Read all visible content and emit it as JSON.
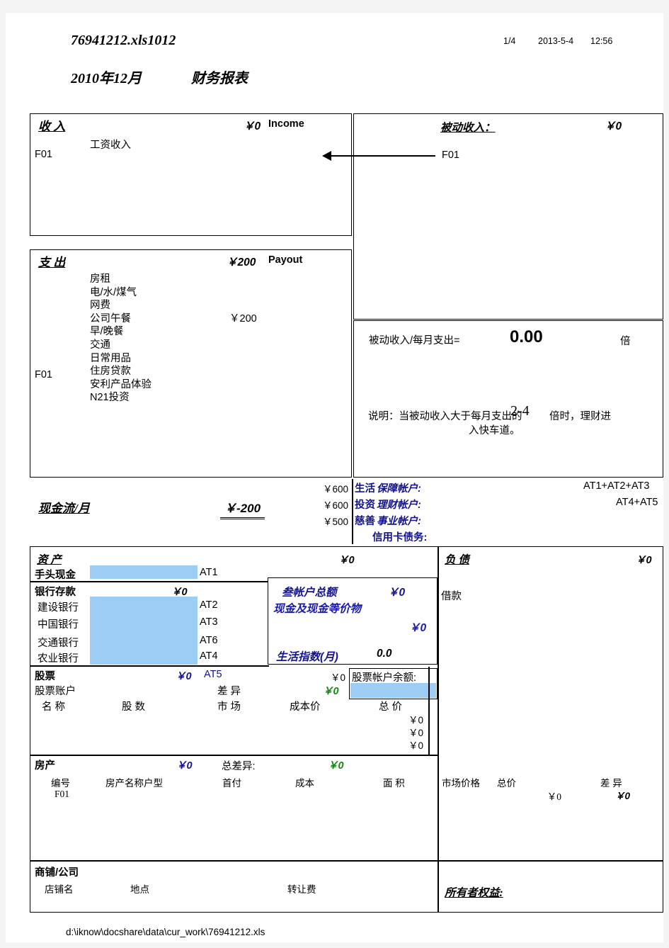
{
  "header": {
    "filename": "76941212.xls1012",
    "page_number": "1/4",
    "date": "2013-5-4",
    "time": "12:56",
    "period": "2010年12月",
    "doc_title": "财务报表"
  },
  "income": {
    "title": "收 入",
    "amount": "￥0",
    "label_en": "Income",
    "items": [
      {
        "name": "工资收入",
        "value": ""
      }
    ],
    "code": "F01"
  },
  "payout": {
    "title": "支 出",
    "amount": "￥200",
    "label_en": "Payout",
    "code": "F01",
    "items": [
      {
        "name": "房租",
        "value": ""
      },
      {
        "name": "电/水/煤气",
        "value": ""
      },
      {
        "name": "网费",
        "value": ""
      },
      {
        "name": "公司午餐",
        "value": "￥200"
      },
      {
        "name": "早/晚餐",
        "value": ""
      },
      {
        "name": "交通",
        "value": ""
      },
      {
        "name": "日常用品",
        "value": ""
      },
      {
        "name": "住房贷款",
        "value": ""
      },
      {
        "name": "安利产品体验",
        "value": ""
      },
      {
        "name": "N21投资",
        "value": ""
      }
    ]
  },
  "passive_income": {
    "title": "被动收入：",
    "amount": "￥0",
    "code": "F01"
  },
  "ratio": {
    "label": "被动收入/每月支出=",
    "value": "0.00",
    "unit": "倍",
    "note_prefix": "说明：当被动收入大于每月支出的",
    "note_value": "2-4",
    "note_suffix": "倍时，理财进",
    "note_line2": "入快车道。"
  },
  "accounts": [
    {
      "amount": "￥600",
      "name_bold": "生活",
      "name_italic": "保障帐户:",
      "code": "AT1+AT2+AT3"
    },
    {
      "amount": "￥600",
      "name_bold": "投资",
      "name_italic": "理财帐户:",
      "code": "AT4+AT5"
    },
    {
      "amount": "￥500",
      "name_bold": "慈善",
      "name_italic": "事业帐户:",
      "code": ""
    }
  ],
  "credit_card": {
    "label": "信用卡债务:"
  },
  "cashflow": {
    "label": "现金流/月",
    "value": "￥-200"
  },
  "assets": {
    "title": "资 产",
    "amount": "￥0",
    "cash_on_hand": {
      "label": "手头现金",
      "value": "",
      "code": "AT1"
    },
    "bank_deposit": {
      "label": "银行存款",
      "amount": "￥0"
    },
    "banks": [
      {
        "name": "建设银行",
        "value": "",
        "code": "AT2"
      },
      {
        "name": "中国银行",
        "value": "",
        "code": "AT3"
      },
      {
        "name": "交通银行",
        "value": "",
        "code": "AT6"
      },
      {
        "name": "农业银行",
        "value": "",
        "code": "AT4"
      }
    ]
  },
  "summary_box": {
    "total_label": "叁帐户总额",
    "total_value": "￥0",
    "cash_equiv_label": "现金及现金等价物",
    "cash_equiv_value": "￥0",
    "life_index_label": "生活指数(月)",
    "life_index_value": "0.0"
  },
  "stocks": {
    "title": "股票",
    "amount": "￥0",
    "code": "AT5",
    "account_label": "股票账户",
    "diff_label": "差 异",
    "diff_small": "￥0",
    "diff_value": "￥0",
    "balance_label": "股票帐户余额:",
    "balance_value": "",
    "columns": [
      "名 称",
      "股 数",
      "市 场",
      "成本价",
      "总 价"
    ],
    "rows": [
      "￥0",
      "￥0",
      "￥0"
    ]
  },
  "property": {
    "title": "房产",
    "amount": "￥0",
    "total_diff_label": "总差异:",
    "total_diff_value": "￥0",
    "columns": [
      "编号",
      "房产名称户型",
      "首付",
      "成本",
      "面 积",
      "市场价格",
      "总价",
      "差 异"
    ],
    "rows": [
      {
        "id": "F01",
        "name": "",
        "downpay": "",
        "cost": "",
        "area": "",
        "market": "",
        "total": "￥0",
        "diff": "￥0"
      }
    ]
  },
  "shop": {
    "title": "商铺/公司",
    "columns": [
      "店铺名",
      "地点",
      "转让费"
    ]
  },
  "liabilities": {
    "title": "负 债",
    "amount": "￥0",
    "items": [
      "借款"
    ]
  },
  "owner_equity": {
    "label": "所有者权益:"
  },
  "footer": {
    "path": "d:\\iknow\\docshare\\data\\cur_work\\76941212.xls"
  }
}
